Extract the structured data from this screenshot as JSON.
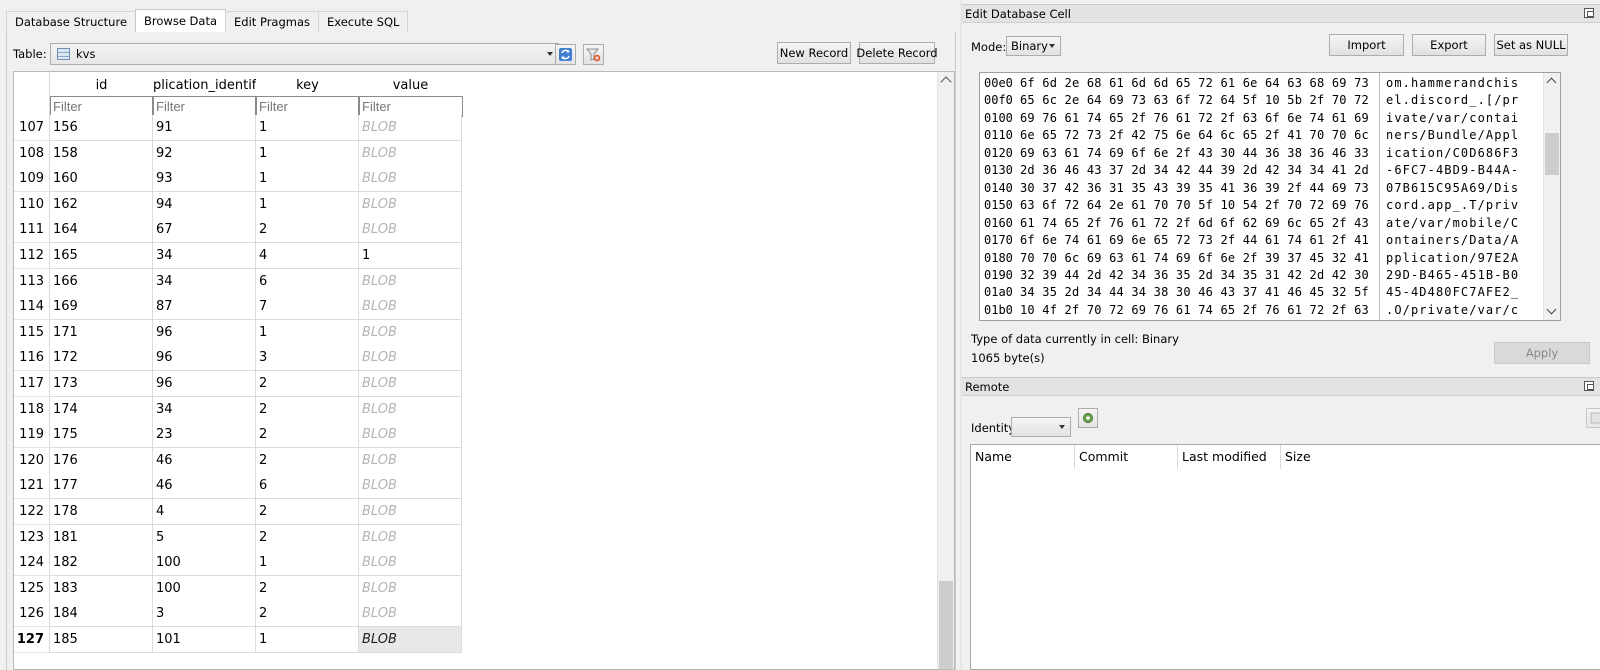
{
  "tabs": [
    "Database Structure",
    "Browse Data",
    "Edit Pragmas",
    "Execute SQL"
  ],
  "active_tab": 1,
  "toolbar": {
    "table_label": "Table:",
    "table_value": "kvs",
    "new_record": "New Record",
    "delete_record": "Delete Record"
  },
  "grid": {
    "columns": [
      "id",
      "plication_identif",
      "key",
      "value"
    ],
    "filter_placeholder": "Filter",
    "rows": [
      {
        "n": "107",
        "id": "156",
        "app": "91",
        "key": "1",
        "value": "BLOB",
        "blob": true
      },
      {
        "n": "108",
        "id": "158",
        "app": "92",
        "key": "1",
        "value": "BLOB",
        "blob": true
      },
      {
        "n": "109",
        "id": "160",
        "app": "93",
        "key": "1",
        "value": "BLOB",
        "blob": true
      },
      {
        "n": "110",
        "id": "162",
        "app": "94",
        "key": "1",
        "value": "BLOB",
        "blob": true
      },
      {
        "n": "111",
        "id": "164",
        "app": "67",
        "key": "2",
        "value": "BLOB",
        "blob": true
      },
      {
        "n": "112",
        "id": "165",
        "app": "34",
        "key": "4",
        "value": "1",
        "blob": false
      },
      {
        "n": "113",
        "id": "166",
        "app": "34",
        "key": "6",
        "value": "BLOB",
        "blob": true
      },
      {
        "n": "114",
        "id": "169",
        "app": "87",
        "key": "7",
        "value": "BLOB",
        "blob": true
      },
      {
        "n": "115",
        "id": "171",
        "app": "96",
        "key": "1",
        "value": "BLOB",
        "blob": true
      },
      {
        "n": "116",
        "id": "172",
        "app": "96",
        "key": "3",
        "value": "BLOB",
        "blob": true
      },
      {
        "n": "117",
        "id": "173",
        "app": "96",
        "key": "2",
        "value": "BLOB",
        "blob": true
      },
      {
        "n": "118",
        "id": "174",
        "app": "34",
        "key": "2",
        "value": "BLOB",
        "blob": true
      },
      {
        "n": "119",
        "id": "175",
        "app": "23",
        "key": "2",
        "value": "BLOB",
        "blob": true
      },
      {
        "n": "120",
        "id": "176",
        "app": "46",
        "key": "2",
        "value": "BLOB",
        "blob": true
      },
      {
        "n": "121",
        "id": "177",
        "app": "46",
        "key": "6",
        "value": "BLOB",
        "blob": true
      },
      {
        "n": "122",
        "id": "178",
        "app": "4",
        "key": "2",
        "value": "BLOB",
        "blob": true
      },
      {
        "n": "123",
        "id": "181",
        "app": "5",
        "key": "2",
        "value": "BLOB",
        "blob": true
      },
      {
        "n": "124",
        "id": "182",
        "app": "100",
        "key": "1",
        "value": "BLOB",
        "blob": true
      },
      {
        "n": "125",
        "id": "183",
        "app": "100",
        "key": "2",
        "value": "BLOB",
        "blob": true
      },
      {
        "n": "126",
        "id": "184",
        "app": "3",
        "key": "2",
        "value": "BLOB",
        "blob": true
      },
      {
        "n": "127",
        "id": "185",
        "app": "101",
        "key": "1",
        "value": "BLOB",
        "blob": true,
        "selected": true
      }
    ]
  },
  "edit_cell": {
    "title": "Edit Database Cell",
    "mode_label": "Mode:",
    "mode_value": "Binary",
    "import": "Import",
    "export": "Export",
    "set_null": "Set as NULL",
    "hex_lines": [
      {
        "off": "00e0",
        "hex": "6f 6d 2e 68 61 6d 6d 65 72 61 6e 64 63 68 69 73",
        "ascii": "om.hammerandchis"
      },
      {
        "off": "00f0",
        "hex": "65 6c 2e 64 69 73 63 6f 72 64 5f 10 5b 2f 70 72",
        "ascii": "el.discord_.[/pr"
      },
      {
        "off": "0100",
        "hex": "69 76 61 74 65 2f 76 61 72 2f 63 6f 6e 74 61 69",
        "ascii": "ivate/var/contai"
      },
      {
        "off": "0110",
        "hex": "6e 65 72 73 2f 42 75 6e 64 6c 65 2f 41 70 70 6c",
        "ascii": "ners/Bundle/Appl"
      },
      {
        "off": "0120",
        "hex": "69 63 61 74 69 6f 6e 2f 43 30 44 36 38 36 46 33",
        "ascii": "ication/C0D686F3"
      },
      {
        "off": "0130",
        "hex": "2d 36 46 43 37 2d 34 42 44 39 2d 42 34 34 41 2d",
        "ascii": "-6FC7-4BD9-B44A-"
      },
      {
        "off": "0140",
        "hex": "30 37 42 36 31 35 43 39 35 41 36 39 2f 44 69 73",
        "ascii": "07B615C95A69/Dis"
      },
      {
        "off": "0150",
        "hex": "63 6f 72 64 2e 61 70 70 5f 10 54 2f 70 72 69 76",
        "ascii": "cord.app_.T/priv"
      },
      {
        "off": "0160",
        "hex": "61 74 65 2f 76 61 72 2f 6d 6f 62 69 6c 65 2f 43",
        "ascii": "ate/var/mobile/C"
      },
      {
        "off": "0170",
        "hex": "6f 6e 74 61 69 6e 65 72 73 2f 44 61 74 61 2f 41",
        "ascii": "ontainers/Data/A"
      },
      {
        "off": "0180",
        "hex": "70 70 6c 69 63 61 74 69 6f 6e 2f 39 37 45 32 41",
        "ascii": "pplication/97E2A"
      },
      {
        "off": "0190",
        "hex": "32 39 44 2d 42 34 36 35 2d 34 35 31 42 2d 42 30",
        "ascii": "29D-B465-451B-B0"
      },
      {
        "off": "01a0",
        "hex": "34 35 2d 34 44 34 38 30 46 43 37 41 46 45 32 5f",
        "ascii": "45-4D480FC7AFE2_"
      },
      {
        "off": "01b0",
        "hex": "10 4f 2f 70 72 69 76 61 74 65 2f 76 61 72 2f 63",
        "ascii": ".O/private/var/c"
      }
    ],
    "type_info": "Type of data currently in cell: Binary",
    "size_info": "1065 byte(s)",
    "apply": "Apply"
  },
  "remote": {
    "title": "Remote",
    "identity_label": "Identity",
    "columns": [
      "Name",
      "Commit",
      "Last modified",
      "Size"
    ]
  }
}
